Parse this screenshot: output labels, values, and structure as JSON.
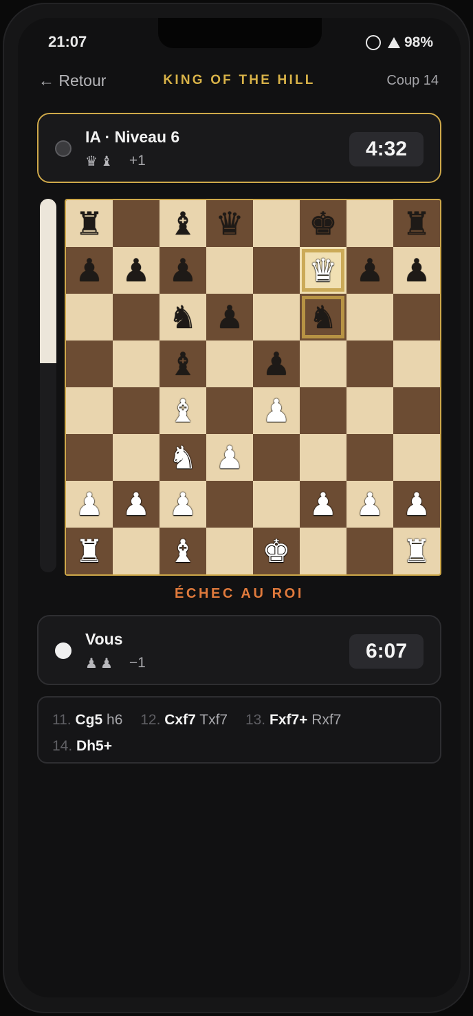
{
  "status_bar": {
    "time": "21:07",
    "battery": "98%"
  },
  "header": {
    "back_label": "← Retour",
    "title": "KING OF THE HILL",
    "move_label": "Coup 14"
  },
  "opponent": {
    "name": "IA · Niveau 6",
    "captured": [
      "♛",
      "♝"
    ],
    "advantage": "+1",
    "clock": "4:32",
    "color": "black"
  },
  "player": {
    "name": "Vous",
    "captured": [
      "♟",
      "♟"
    ],
    "advantage": "−1",
    "clock": "6:07",
    "color": "white"
  },
  "eval_bar": {
    "white_fraction": 0.44
  },
  "board": {
    "colors": {
      "light": "#e9d5ae",
      "dark": "#6c4c33",
      "highlight": "#cfa94a"
    },
    "highlighted": [
      "f7",
      "f6"
    ],
    "ranks": [
      [
        "bR",
        "",
        "bB",
        "bQ",
        "",
        "bK",
        "",
        "bR"
      ],
      [
        "bP",
        "bP",
        "bP",
        "",
        "",
        "wQ",
        "bP",
        "bP"
      ],
      [
        "",
        "",
        "bN",
        "bP",
        "",
        "bN",
        "",
        ""
      ],
      [
        "",
        "",
        "bB",
        "",
        "bP",
        "",
        "",
        ""
      ],
      [
        "",
        "",
        "wB",
        "",
        "wP",
        "",
        "",
        ""
      ],
      [
        "",
        "",
        "wN",
        "wP",
        "",
        "",
        "",
        ""
      ],
      [
        "wP",
        "wP",
        "wP",
        "",
        "",
        "wP",
        "wP",
        "wP"
      ],
      [
        "wR",
        "",
        "wB",
        "",
        "wK",
        "",
        "",
        "wR"
      ]
    ]
  },
  "check_label": "ÉCHEC AU ROI",
  "moves": [
    {
      "num": "11.",
      "white": "Cg5",
      "black": "h6"
    },
    {
      "num": "12.",
      "white": "Cxf7",
      "black": "Txf7"
    },
    {
      "num": "13.",
      "white": "Fxf7+",
      "black": "Rxf7"
    },
    {
      "num": "14.",
      "white": "Dh5+",
      "black": ""
    }
  ]
}
